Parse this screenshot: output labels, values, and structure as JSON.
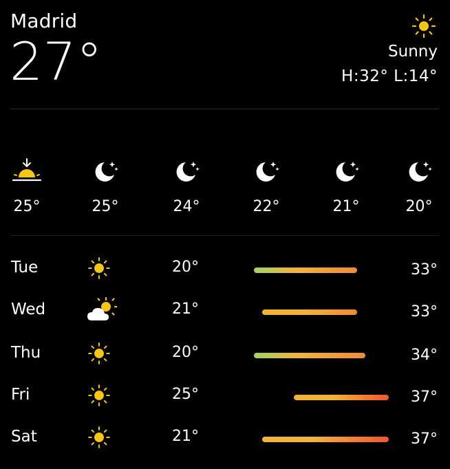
{
  "location": {
    "city": "Madrid",
    "current_temp": "27°",
    "condition": "Sunny",
    "high_low": "H:32° L:14°",
    "condition_icon": "sun-icon"
  },
  "hourly": [
    {
      "icon": "sunset-icon",
      "temp": "25°"
    },
    {
      "icon": "moon-stars-icon",
      "temp": "25°"
    },
    {
      "icon": "moon-stars-icon",
      "temp": "24°"
    },
    {
      "icon": "moon-stars-icon",
      "temp": "22°"
    },
    {
      "icon": "moon-stars-icon",
      "temp": "21°"
    },
    {
      "icon": "moon-stars-icon",
      "temp": "20°"
    }
  ],
  "daily": [
    {
      "day": "Tue",
      "icon": "sun-icon",
      "low": "20°",
      "high": "33°",
      "low_value": 20,
      "high_value": 33
    },
    {
      "day": "Wed",
      "icon": "partly-cloudy-icon",
      "low": "21°",
      "high": "33°",
      "low_value": 21,
      "high_value": 33
    },
    {
      "day": "Thu",
      "icon": "sun-icon",
      "low": "20°",
      "high": "34°",
      "low_value": 20,
      "high_value": 34
    },
    {
      "day": "Fri",
      "icon": "sun-icon",
      "low": "25°",
      "high": "37°",
      "low_value": 25,
      "high_value": 37
    },
    {
      "day": "Sat",
      "icon": "sun-icon",
      "low": "21°",
      "high": "37°",
      "low_value": 21,
      "high_value": 37
    }
  ],
  "colors": {
    "sun": "#f5c518",
    "cool": "#9fd36a",
    "warm": "#f3b33a",
    "hot": "#f0562e"
  }
}
